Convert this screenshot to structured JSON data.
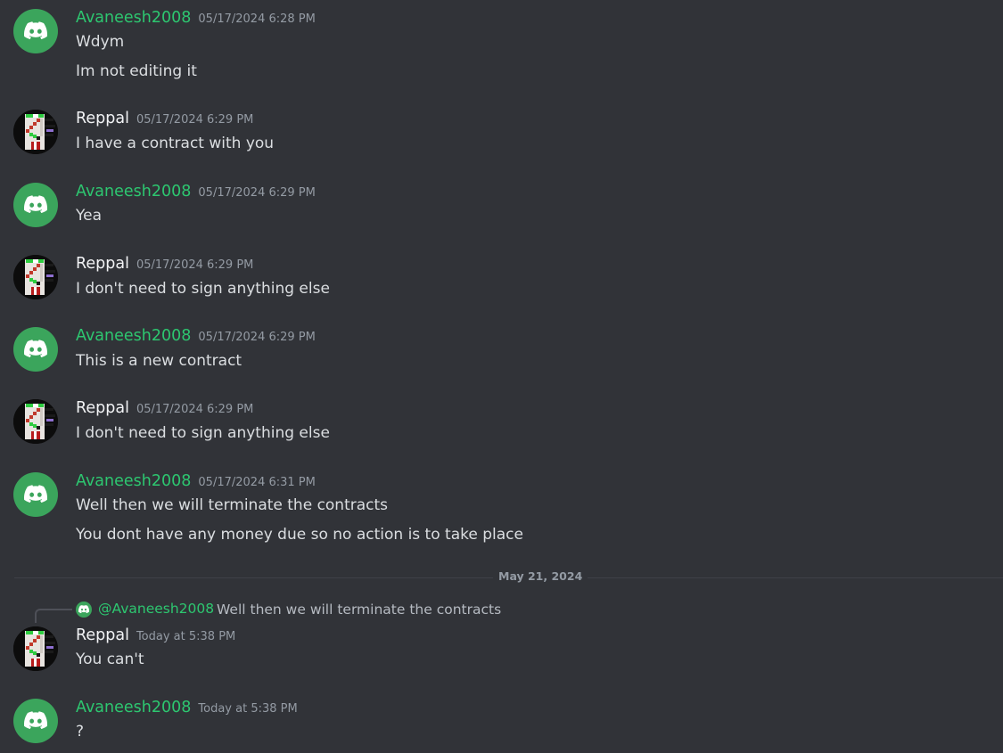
{
  "colors": {
    "background": "#313338",
    "username_green": "#2dc770",
    "username_white": "#f2f3f5",
    "text": "#dbdee1",
    "timestamp": "#949ba4",
    "discord_avatar_bg": "#3ba55c"
  },
  "messages": [
    {
      "author": "Avaneesh2008",
      "avatar_icon": "discord-logo-icon",
      "timestamp": "05/17/2024 6:28 PM",
      "lines": [
        "Wdym",
        "Im not editing it"
      ]
    },
    {
      "author": "Reppal",
      "avatar_icon": "pixel-art-avatar",
      "timestamp": "05/17/2024 6:29 PM",
      "lines": [
        "I have a contract with you"
      ]
    },
    {
      "author": "Avaneesh2008",
      "avatar_icon": "discord-logo-icon",
      "timestamp": "05/17/2024 6:29 PM",
      "lines": [
        "Yea"
      ]
    },
    {
      "author": "Reppal",
      "avatar_icon": "pixel-art-avatar",
      "timestamp": "05/17/2024 6:29 PM",
      "lines": [
        "I don't need to sign anything else"
      ]
    },
    {
      "author": "Avaneesh2008",
      "avatar_icon": "discord-logo-icon",
      "timestamp": "05/17/2024 6:29 PM",
      "lines": [
        "This is a new contract"
      ]
    },
    {
      "author": "Reppal",
      "avatar_icon": "pixel-art-avatar",
      "timestamp": "05/17/2024 6:29 PM",
      "lines": [
        "I don't need to sign anything else"
      ]
    },
    {
      "author": "Avaneesh2008",
      "avatar_icon": "discord-logo-icon",
      "timestamp": "05/17/2024 6:31 PM",
      "lines": [
        "Well then we will terminate the contracts",
        "You dont have any money due so no action is to take place"
      ]
    },
    {
      "author": "Reppal",
      "avatar_icon": "pixel-art-avatar",
      "timestamp": "Today at 5:38 PM",
      "reply": {
        "mention": "@Avaneesh2008",
        "text": "Well then we will terminate the contracts"
      },
      "lines": [
        "You can't"
      ]
    },
    {
      "author": "Avaneesh2008",
      "avatar_icon": "discord-logo-icon",
      "timestamp": "Today at 5:38 PM",
      "lines": [
        "?"
      ]
    }
  ],
  "date_divider": {
    "label": "May 21, 2024"
  }
}
